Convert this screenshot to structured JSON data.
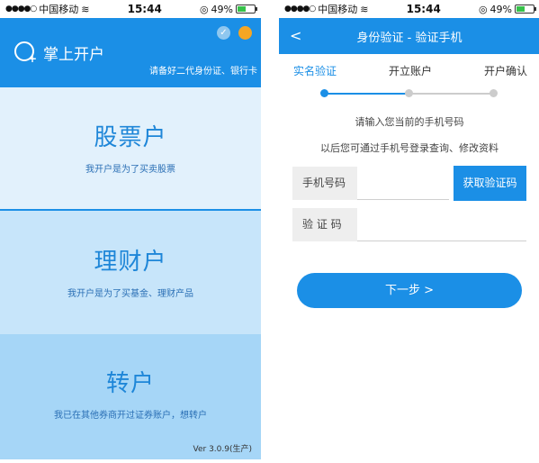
{
  "status": {
    "carrier": "中国移动",
    "signal": "●●●●○",
    "time": "15:44",
    "battery": "49%",
    "battery_level": 0.49
  },
  "left": {
    "app_title": "掌上开户",
    "marquee": "请备好二代身份证、银行卡",
    "options": [
      {
        "title": "股票户",
        "desc": "我开户是为了买卖股票"
      },
      {
        "title": "理财户",
        "desc": "我开户是为了买基金、理财产品"
      },
      {
        "title": "转户",
        "desc": "我已在其他券商开过证券账户，想转户"
      }
    ],
    "version": "Ver 3.0.9(生产)"
  },
  "right": {
    "back": "<",
    "nav_title": "身份验证 - 验证手机",
    "steps": [
      "实名验证",
      "开立账户",
      "开户确认"
    ],
    "hint1": "请输入您当前的手机号码",
    "hint2": "以后您可通过手机号登录查询、修改资料",
    "phone_label": "手机号码",
    "code_label": "验 证 码",
    "get_code": "获取验证码",
    "next": "下一步 >"
  },
  "colors": {
    "brand": "#1b8fe6",
    "orange": "#f5a623"
  }
}
